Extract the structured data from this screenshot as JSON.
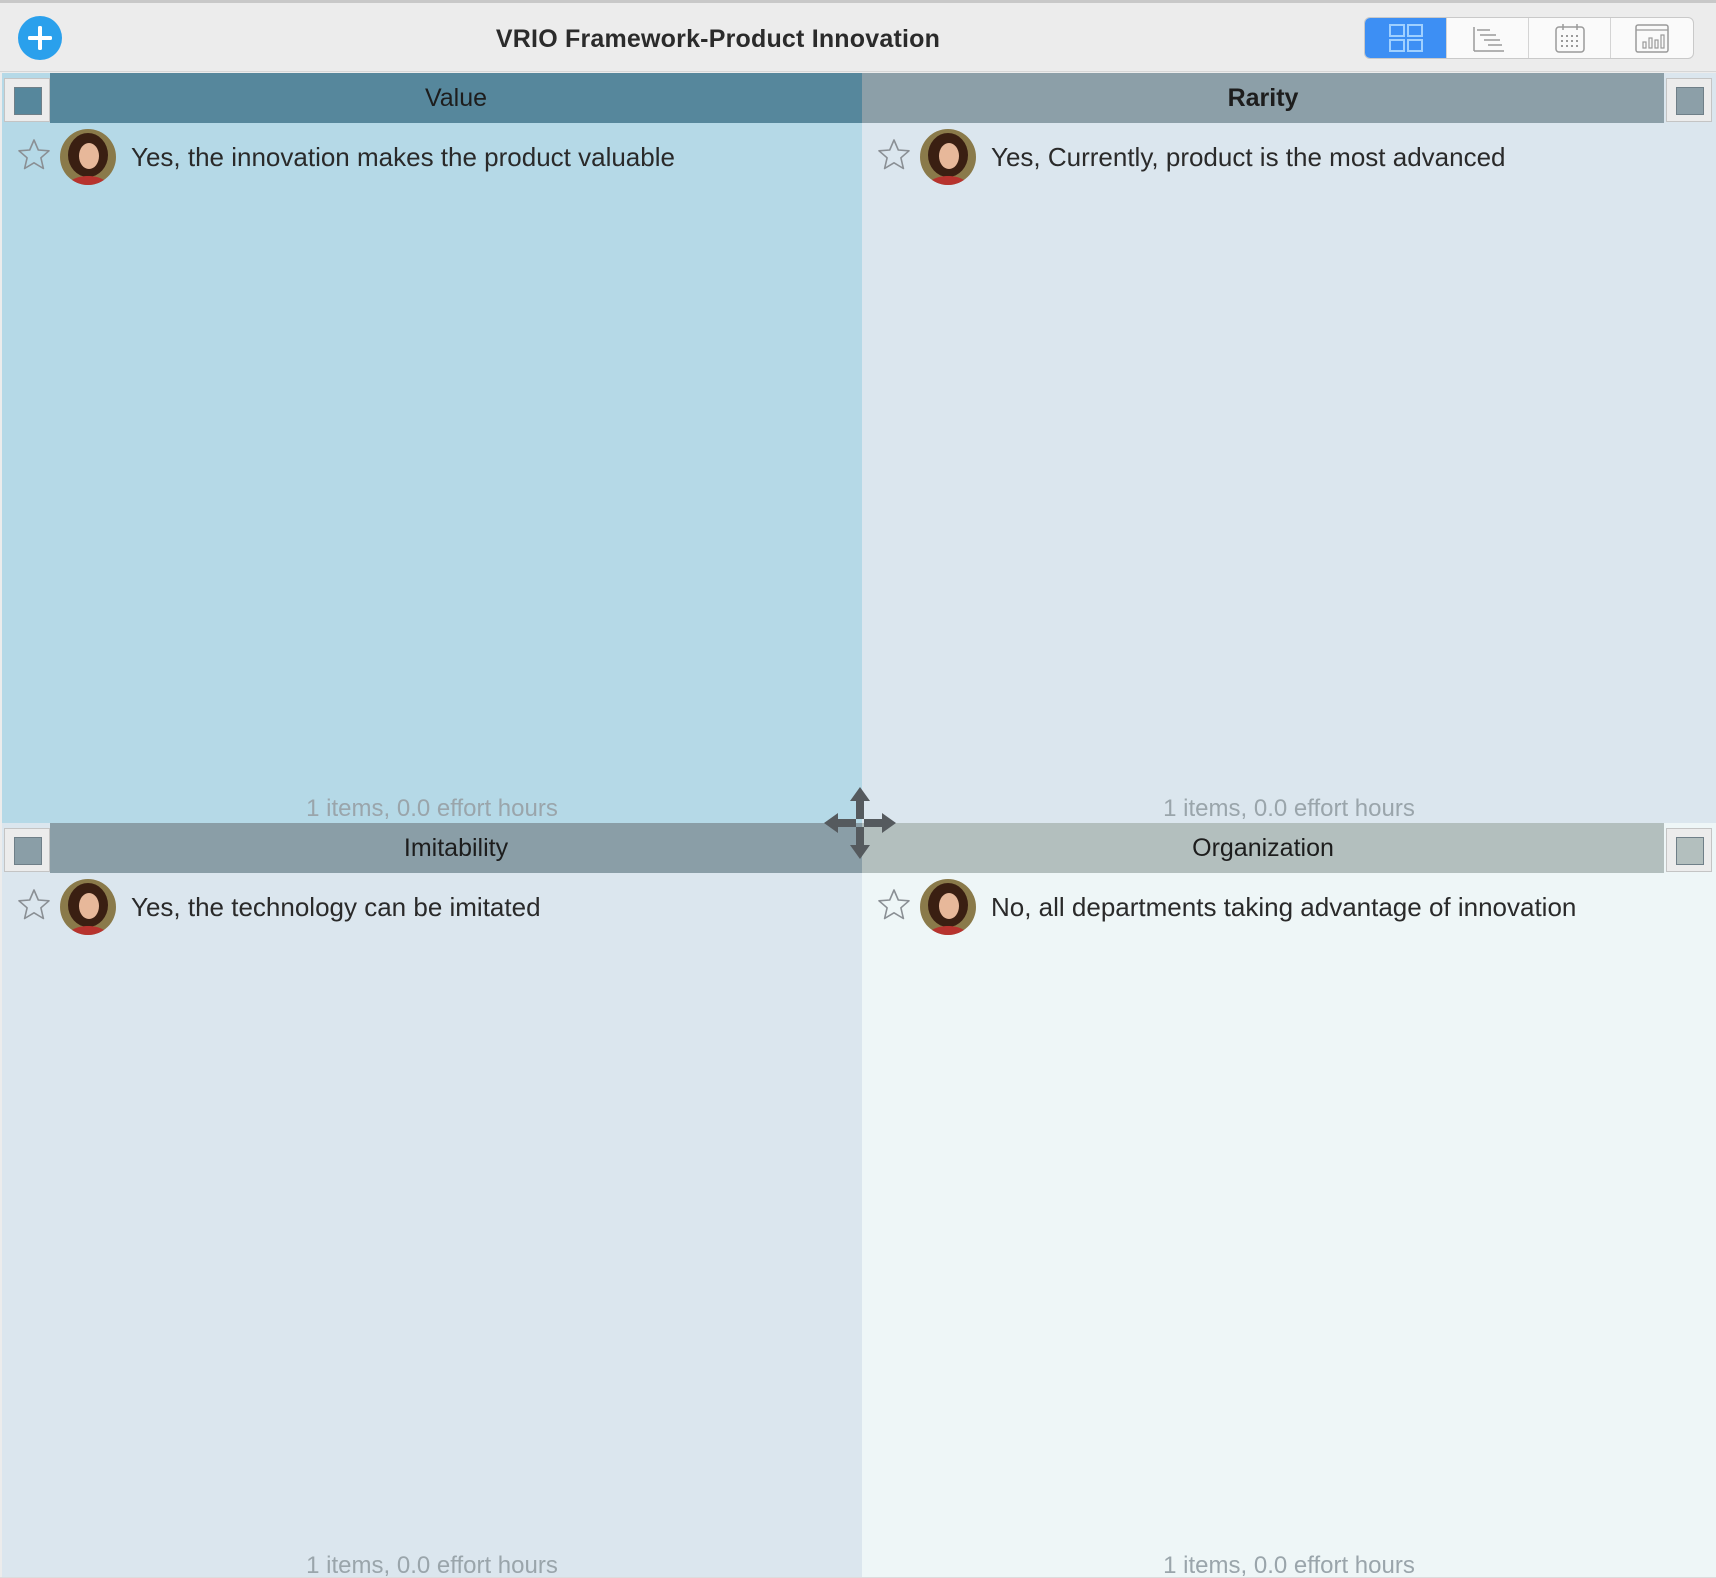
{
  "window": {
    "title": "VRIO Framework-Product Innovation"
  },
  "toolbar": {
    "add_icon": "plus-circle-icon",
    "views": [
      {
        "name": "matrix-view",
        "icon": "grid-icon",
        "active": true
      },
      {
        "name": "outline-view",
        "icon": "gantt-icon",
        "active": false
      },
      {
        "name": "calendar-view",
        "icon": "calendar-icon",
        "active": false
      },
      {
        "name": "report-view",
        "icon": "bar-chart-icon",
        "active": false
      }
    ]
  },
  "quadrants": [
    {
      "title": "Value",
      "color": "#56879c",
      "items": [
        {
          "text": "Yes, the innovation makes the product valuable",
          "starred": false
        }
      ],
      "summary": "1 items, 0.0 effort hours"
    },
    {
      "title": "Rarity",
      "color": "#8c9fa8",
      "items": [
        {
          "text": "Yes, Currently, product is the most advanced",
          "starred": false
        }
      ],
      "summary": "1 items, 0.0 effort hours"
    },
    {
      "title": "Imitability",
      "color": "#8a9ea7",
      "items": [
        {
          "text": "Yes, the technology can be imitated",
          "starred": false
        }
      ],
      "summary": "1 items, 0.0 effort hours"
    },
    {
      "title": "Organization",
      "color": "#b3bfbe",
      "items": [
        {
          "text": "No, all departments taking advantage of innovation",
          "starred": false
        }
      ],
      "summary": "1 items, 0.0 effort hours"
    }
  ],
  "colors": {
    "accent": "#2aa0ec",
    "active_view": "#3d8ff4",
    "value_bg": "#b5d9e7",
    "rarity_bg": "#dbe6ee",
    "imitability_bg": "#dbe6ee",
    "organization_bg": "#eef6f7"
  }
}
